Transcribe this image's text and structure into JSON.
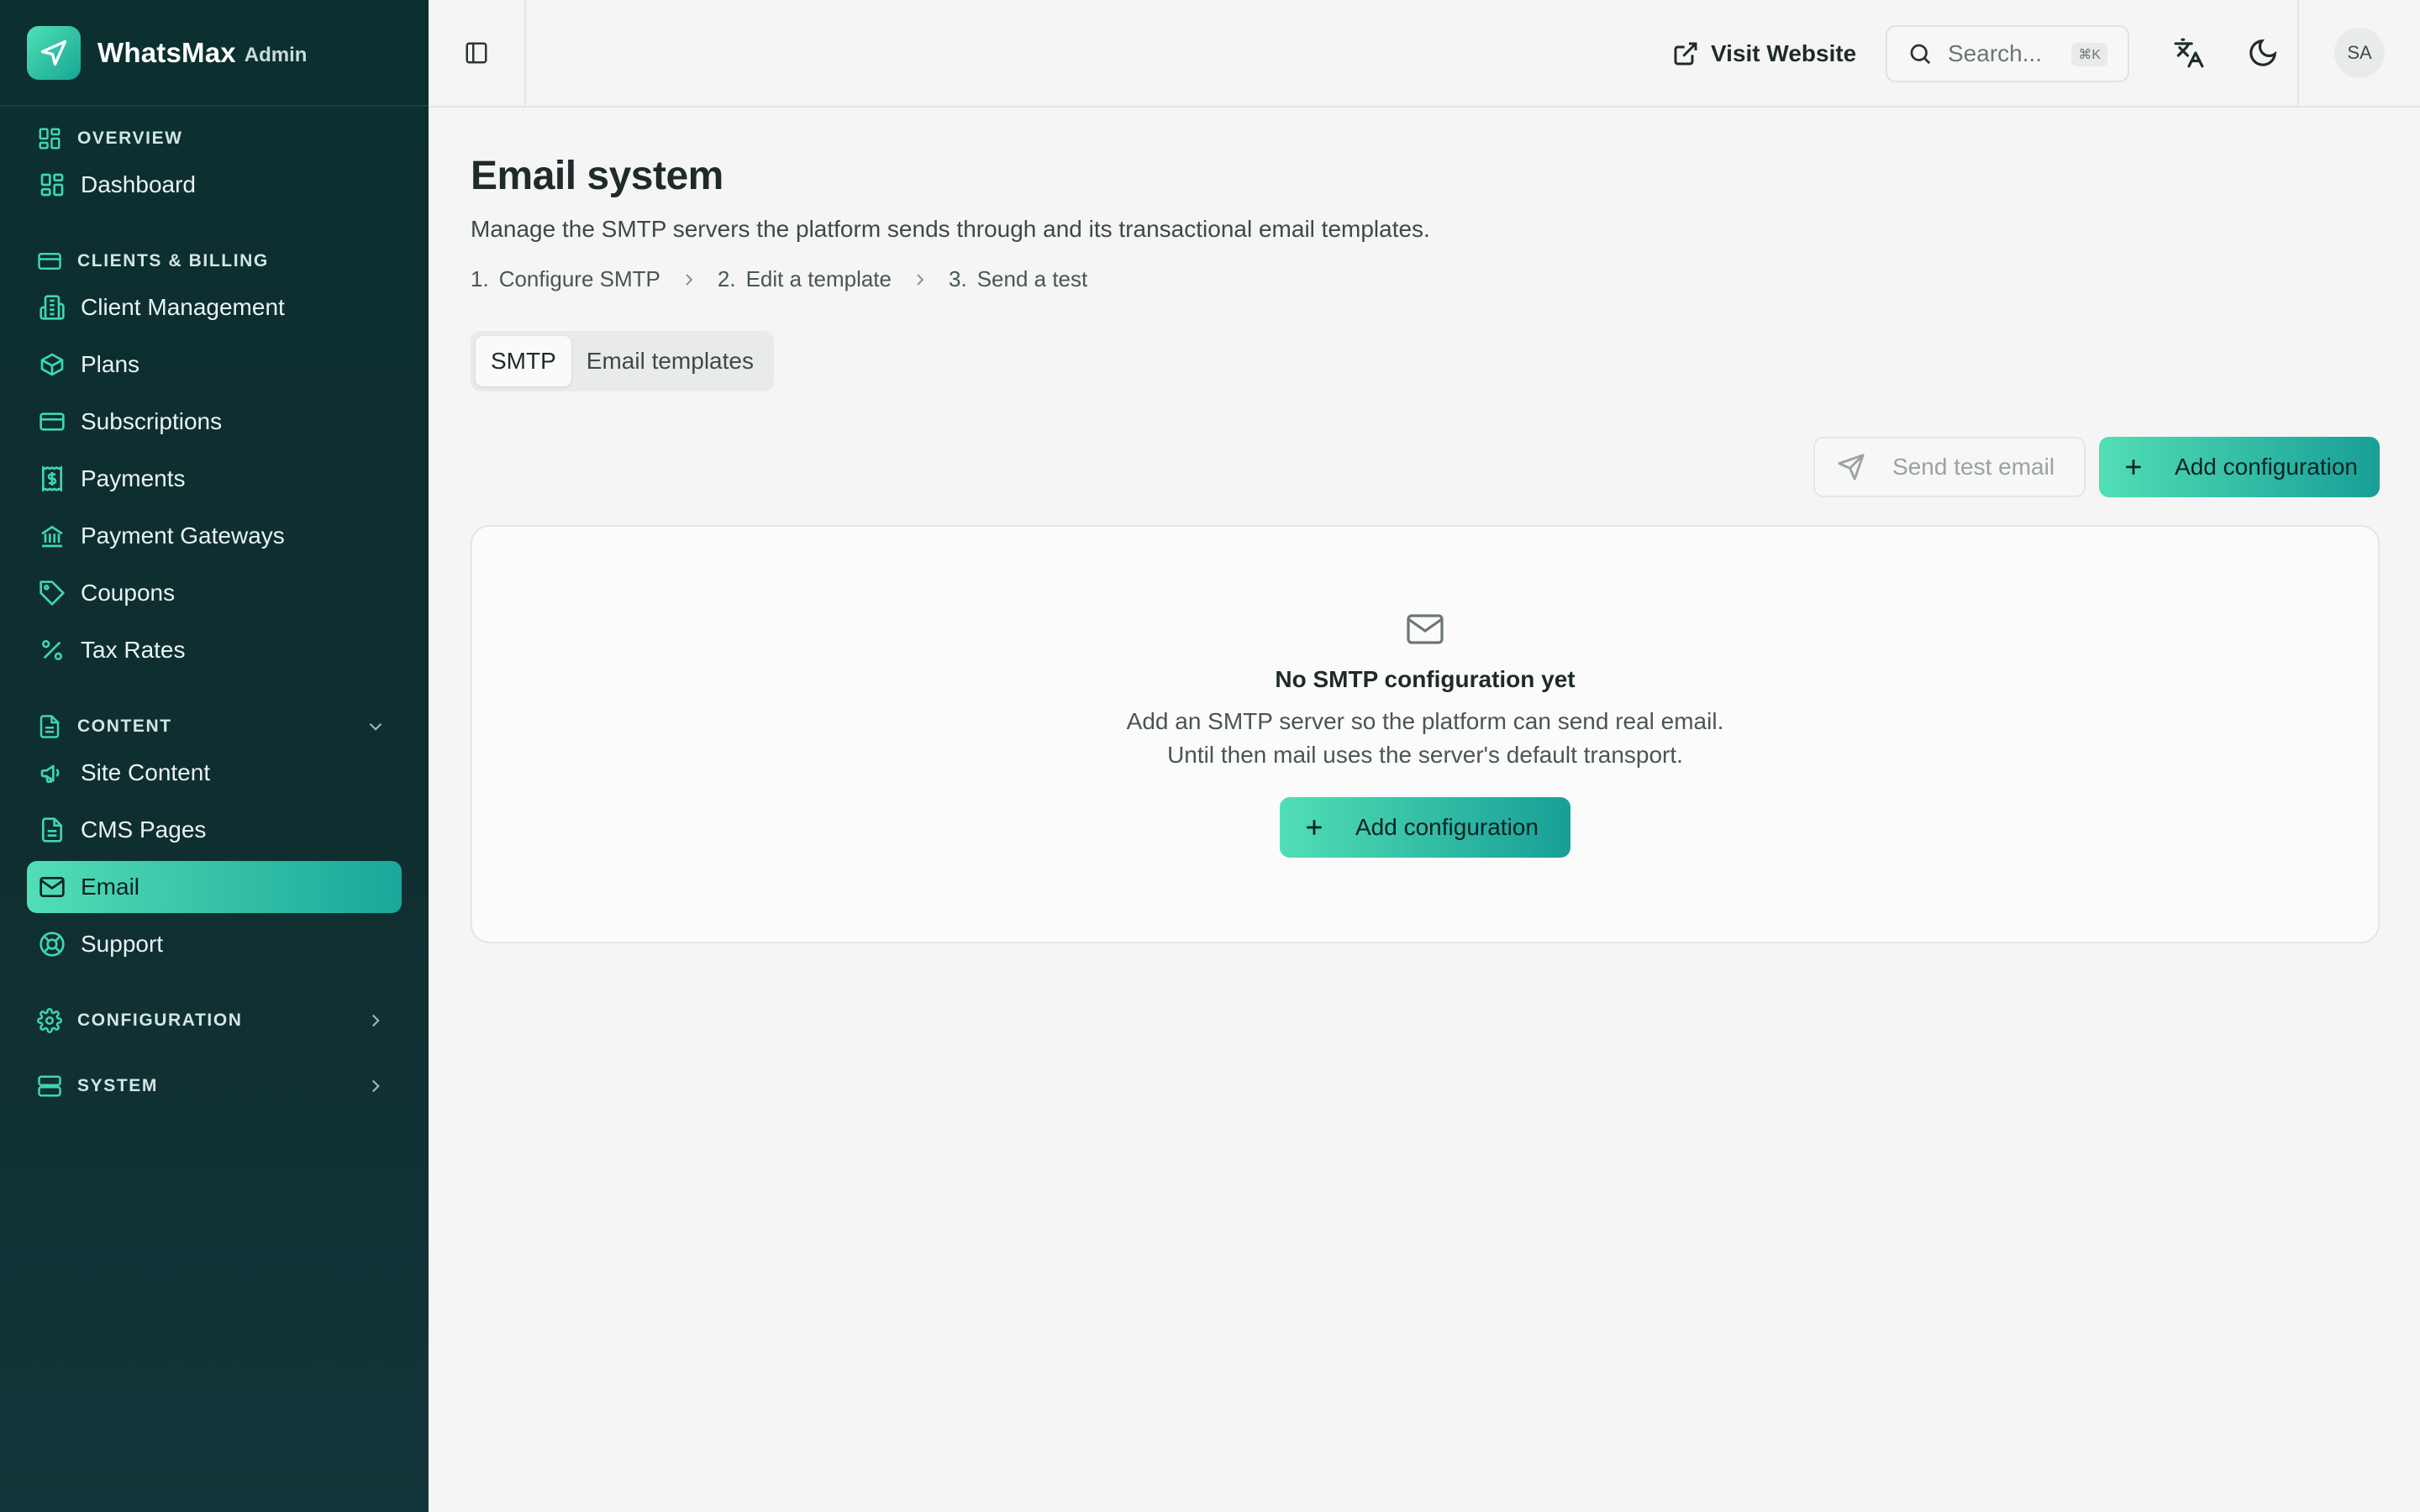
{
  "brand": {
    "name": "WhatsMax",
    "sub": "Admin"
  },
  "sidebar": {
    "sections": [
      {
        "label": "OVERVIEW",
        "icon": "layout-dashboard-icon",
        "items": [
          {
            "label": "Dashboard",
            "icon": "layout-dashboard-icon"
          }
        ]
      },
      {
        "label": "CLIENTS & BILLING",
        "icon": "credit-card-icon",
        "items": [
          {
            "label": "Client Management",
            "icon": "building-icon"
          },
          {
            "label": "Plans",
            "icon": "package-icon"
          },
          {
            "label": "Subscriptions",
            "icon": "credit-card-icon"
          },
          {
            "label": "Payments",
            "icon": "receipt-dollar-icon"
          },
          {
            "label": "Payment Gateways",
            "icon": "bank-icon"
          },
          {
            "label": "Coupons",
            "icon": "tag-icon"
          },
          {
            "label": "Tax Rates",
            "icon": "percent-icon"
          }
        ]
      },
      {
        "label": "CONTENT",
        "icon": "file-text-icon",
        "expanded": true,
        "items": [
          {
            "label": "Site Content",
            "icon": "megaphone-icon"
          },
          {
            "label": "CMS Pages",
            "icon": "file-text-icon"
          },
          {
            "label": "Email",
            "icon": "mail-icon",
            "active": true
          },
          {
            "label": "Support",
            "icon": "life-buoy-icon"
          }
        ]
      },
      {
        "label": "CONFIGURATION",
        "icon": "gear-icon",
        "expanded": false,
        "items": []
      },
      {
        "label": "SYSTEM",
        "icon": "server-icon",
        "expanded": false,
        "items": []
      }
    ]
  },
  "header": {
    "visit_label": "Visit Website",
    "search_placeholder": "Search...",
    "search_shortcut": "⌘K",
    "avatar_initials": "SA"
  },
  "page": {
    "title": "Email system",
    "description": "Manage the SMTP servers the platform sends through and its transactional email templates.",
    "steps": [
      {
        "num": "1.",
        "label": "Configure SMTP"
      },
      {
        "num": "2.",
        "label": "Edit a template"
      },
      {
        "num": "3.",
        "label": "Send a test"
      }
    ],
    "tabs": [
      {
        "label": "SMTP",
        "active": true
      },
      {
        "label": "Email templates",
        "active": false
      }
    ],
    "actions": {
      "send_test_label": "Send test email",
      "add_config_label": "Add configuration"
    },
    "empty_state": {
      "title": "No SMTP configuration yet",
      "line1": "Add an SMTP server so the platform can send real email.",
      "line2": "Until then mail uses the server's default transport.",
      "button_label": "Add configuration"
    }
  },
  "colors": {
    "sidebar_bg": "#0c2f2f",
    "accent_start": "#52deb5",
    "accent_end": "#179f97",
    "page_bg": "#f5f5f5"
  }
}
